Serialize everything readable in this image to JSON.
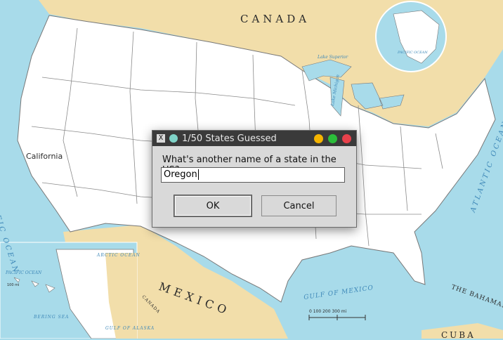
{
  "map": {
    "canada": "CANADA",
    "mexico": "MEXICO",
    "california": "California",
    "pacific_ocean": "PACIFIC OCEAN",
    "atlantic_ocean": "ATLANTIC OCEAN",
    "gulf_of_mexico": "GULF OF MEXICO",
    "bahamas": "THE BAHAMAS",
    "cuba": "CUBA",
    "arctic_ocean": "ARCTIC OCEAN",
    "bering_sea": "BERING SEA",
    "gulf_of_alaska": "GULF OF ALASKA",
    "canada_small": "CANADA",
    "inset_pacific": "PACIFIC OCEAN",
    "lake_superior": "Lake Superior",
    "lake_michigan": "Lake Michigan",
    "globe_pacific": "PACIFIC OCEAN",
    "scale_main": "0 100 200 300 mi",
    "scale_inset": "100 mi"
  },
  "dialog": {
    "title": "1/50 States Guessed",
    "prompt": "What's another name of a state in the US?",
    "input_value": "Oregon",
    "ok_label": "OK",
    "cancel_label": "Cancel",
    "colors": {
      "minimize": "#f5b400",
      "maximize": "#2bbd3a",
      "close": "#e8414b",
      "titlebar": "#3a3a3a"
    }
  }
}
